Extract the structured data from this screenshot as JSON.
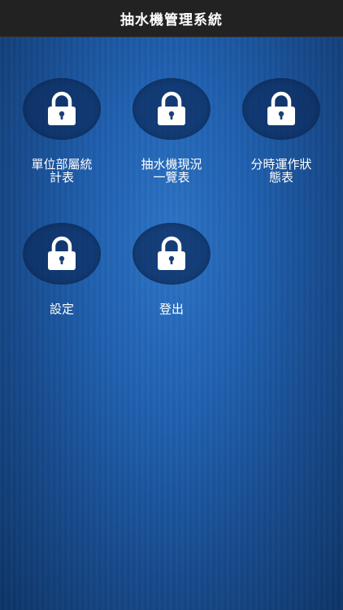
{
  "header": {
    "title": "抽水機管理系統"
  },
  "menu": {
    "items": [
      {
        "label": "單位部屬統\n計表",
        "icon": "lock-icon"
      },
      {
        "label": "抽水機現況\n一覽表",
        "icon": "lock-icon"
      },
      {
        "label": "分時運作狀\n態表",
        "icon": "lock-icon"
      },
      {
        "label": "設定",
        "icon": "lock-icon"
      },
      {
        "label": "登出",
        "icon": "lock-icon"
      }
    ]
  },
  "colors": {
    "header_bg": "#222222",
    "background": "#1f5fae",
    "icon_circle": "#0e2e60",
    "text": "#ffffff"
  }
}
